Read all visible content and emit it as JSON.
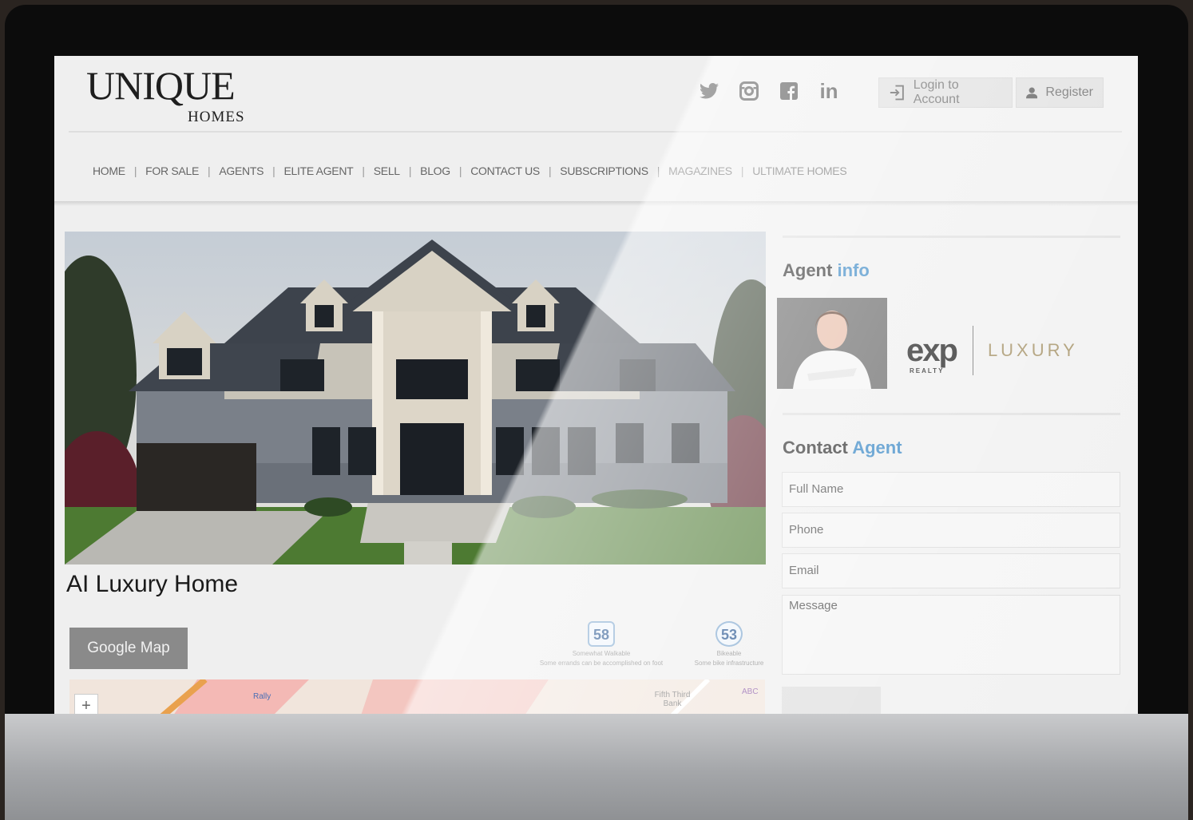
{
  "site": {
    "logo_main": "UNIQUE",
    "logo_sub": "HOMES"
  },
  "social": [
    "twitter-icon",
    "instagram-icon",
    "facebook-icon",
    "linkedin-icon"
  ],
  "account": {
    "login_label": "Login to Account",
    "register_label": "Register"
  },
  "nav": {
    "items": [
      "HOME",
      "FOR SALE",
      "AGENTS",
      "ELITE AGENT",
      "SELL",
      "BLOG",
      "CONTACT US",
      "SUBSCRIPTIONS",
      "MAGAZINES",
      "ULTIMATE HOMES"
    ]
  },
  "listing": {
    "title": "AI Luxury Home",
    "google_map_label": "Google Map",
    "walk_score": {
      "value": "58",
      "label": "Somewhat Walkable",
      "desc": "Some errands can be accomplished on foot"
    },
    "bike_score": {
      "value": "53",
      "label": "Bikeable",
      "desc": "Some bike infrastructure"
    },
    "map_labels": [
      "Rally",
      "Fifth Third Bank",
      "ABC"
    ]
  },
  "agent": {
    "section_title_a": "Agent",
    "section_title_b": "info",
    "brand": "exp",
    "brand_sub": "REALTY",
    "brand_tag": "LUXURY"
  },
  "contact": {
    "section_title_a": "Contact",
    "section_title_b": "Agent",
    "full_name_placeholder": "Full Name",
    "phone_placeholder": "Phone",
    "email_placeholder": "Email",
    "message_placeholder": "Message"
  }
}
